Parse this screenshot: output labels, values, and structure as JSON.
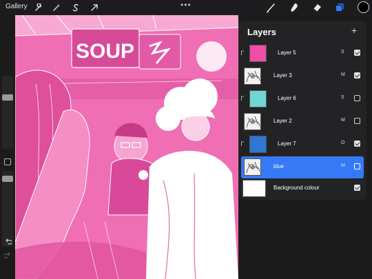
{
  "toolbar": {
    "gallery_label": "Gallery",
    "menu_dots": "•••",
    "left_tools": [
      "actions-wrench-icon",
      "adjustments-wand-icon",
      "selection-s-icon",
      "transform-arrow-icon"
    ],
    "right_tools": [
      "brush-icon",
      "smudge-icon",
      "eraser-icon",
      "layers-icon"
    ],
    "current_color": "#000000",
    "layers_accent": "#3579f6"
  },
  "sidebar": {
    "brush_size_level": 0.25,
    "opacity_level": 0.3,
    "icons": [
      "modify-square-icon",
      "undo-icon",
      "redo-icon"
    ]
  },
  "canvas": {
    "tint": "#f06fb4",
    "sign_text": "SOUP"
  },
  "layers_panel": {
    "title": "Layers",
    "add_label": "+",
    "layers": [
      {
        "name": "Layer 5",
        "mode": "S",
        "visible": true,
        "clipped": true,
        "thumb": "#ef4ea5"
      },
      {
        "name": "Layer 3",
        "mode": "M",
        "visible": true,
        "clipped": false,
        "thumb": "sketch"
      },
      {
        "name": "Layer 6",
        "mode": "S",
        "visible": false,
        "clipped": true,
        "thumb": "#6fd8d2"
      },
      {
        "name": "Layer 2",
        "mode": "M",
        "visible": false,
        "clipped": false,
        "thumb": "sketch"
      },
      {
        "name": "Layer 7",
        "mode": "O",
        "visible": true,
        "clipped": true,
        "thumb": "#2f78d2"
      },
      {
        "name": "blue",
        "mode": "M",
        "visible": false,
        "clipped": false,
        "thumb": "sketch",
        "active": true
      },
      {
        "name": "Background colour",
        "mode": "",
        "visible": true,
        "clipped": false,
        "thumb": "#ffffff"
      }
    ]
  }
}
